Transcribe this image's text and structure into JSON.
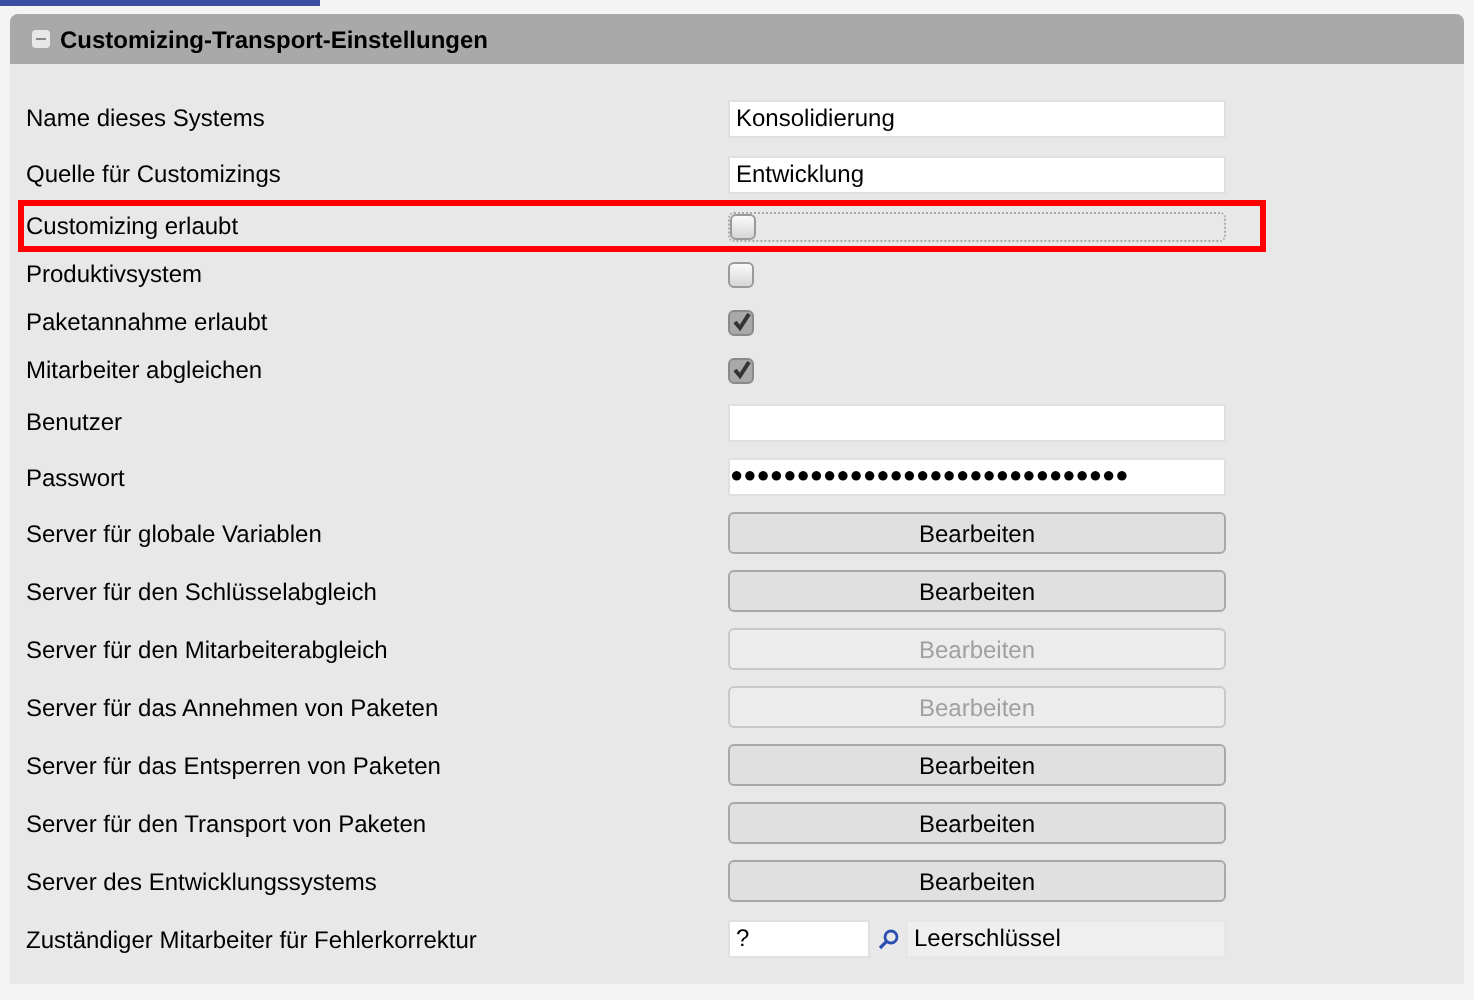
{
  "panel": {
    "title": "Customizing-Transport-Einstellungen",
    "expanded": true
  },
  "rows": [
    {
      "kind": "text",
      "label": "Name dieses Systems",
      "value": "Konsolidierung"
    },
    {
      "kind": "text",
      "label": "Quelle für Customizings",
      "value": "Entwicklung"
    },
    {
      "kind": "checkbox",
      "label": "Customizing erlaubt",
      "checked": false,
      "disabled": false,
      "highlighted": true
    },
    {
      "kind": "checkbox",
      "label": "Produktivsystem",
      "checked": false,
      "disabled": false,
      "highlighted": false
    },
    {
      "kind": "checkbox",
      "label": "Paketannahme erlaubt",
      "checked": true,
      "disabled": true,
      "highlighted": false
    },
    {
      "kind": "checkbox",
      "label": "Mitarbeiter abgleichen",
      "checked": true,
      "disabled": true,
      "highlighted": false
    },
    {
      "kind": "text",
      "label": "Benutzer"
    },
    {
      "kind": "password",
      "label": "Passwort",
      "value": "●●●●●●●●●●●●●●●●●●●●●●●●●●●●●●"
    },
    {
      "kind": "button",
      "label": "Server für globale Variablen",
      "button": "Bearbeiten",
      "disabled": false
    },
    {
      "kind": "button",
      "label": "Server für den Schlüsselabgleich",
      "button": "Bearbeiten",
      "disabled": false
    },
    {
      "kind": "button",
      "label": "Server für den Mitarbeiterabgleich",
      "button": "Bearbeiten",
      "disabled": true
    },
    {
      "kind": "button",
      "label": "Server für das Annehmen von Paketen",
      "button": "Bearbeiten",
      "disabled": true
    },
    {
      "kind": "button",
      "label": "Server für das Entsperren von Paketen",
      "button": "Bearbeiten",
      "disabled": false
    },
    {
      "kind": "button",
      "label": "Server für den Transport von Paketen",
      "button": "Bearbeiten",
      "disabled": false
    },
    {
      "kind": "button",
      "label": "Server des Entwicklungssystems",
      "button": "Bearbeiten",
      "disabled": false
    },
    {
      "kind": "lookup",
      "label": "Zuständiger Mitarbeiter für Fehlerkorrektur",
      "value": "?",
      "description": "Leerschlüssel"
    }
  ]
}
